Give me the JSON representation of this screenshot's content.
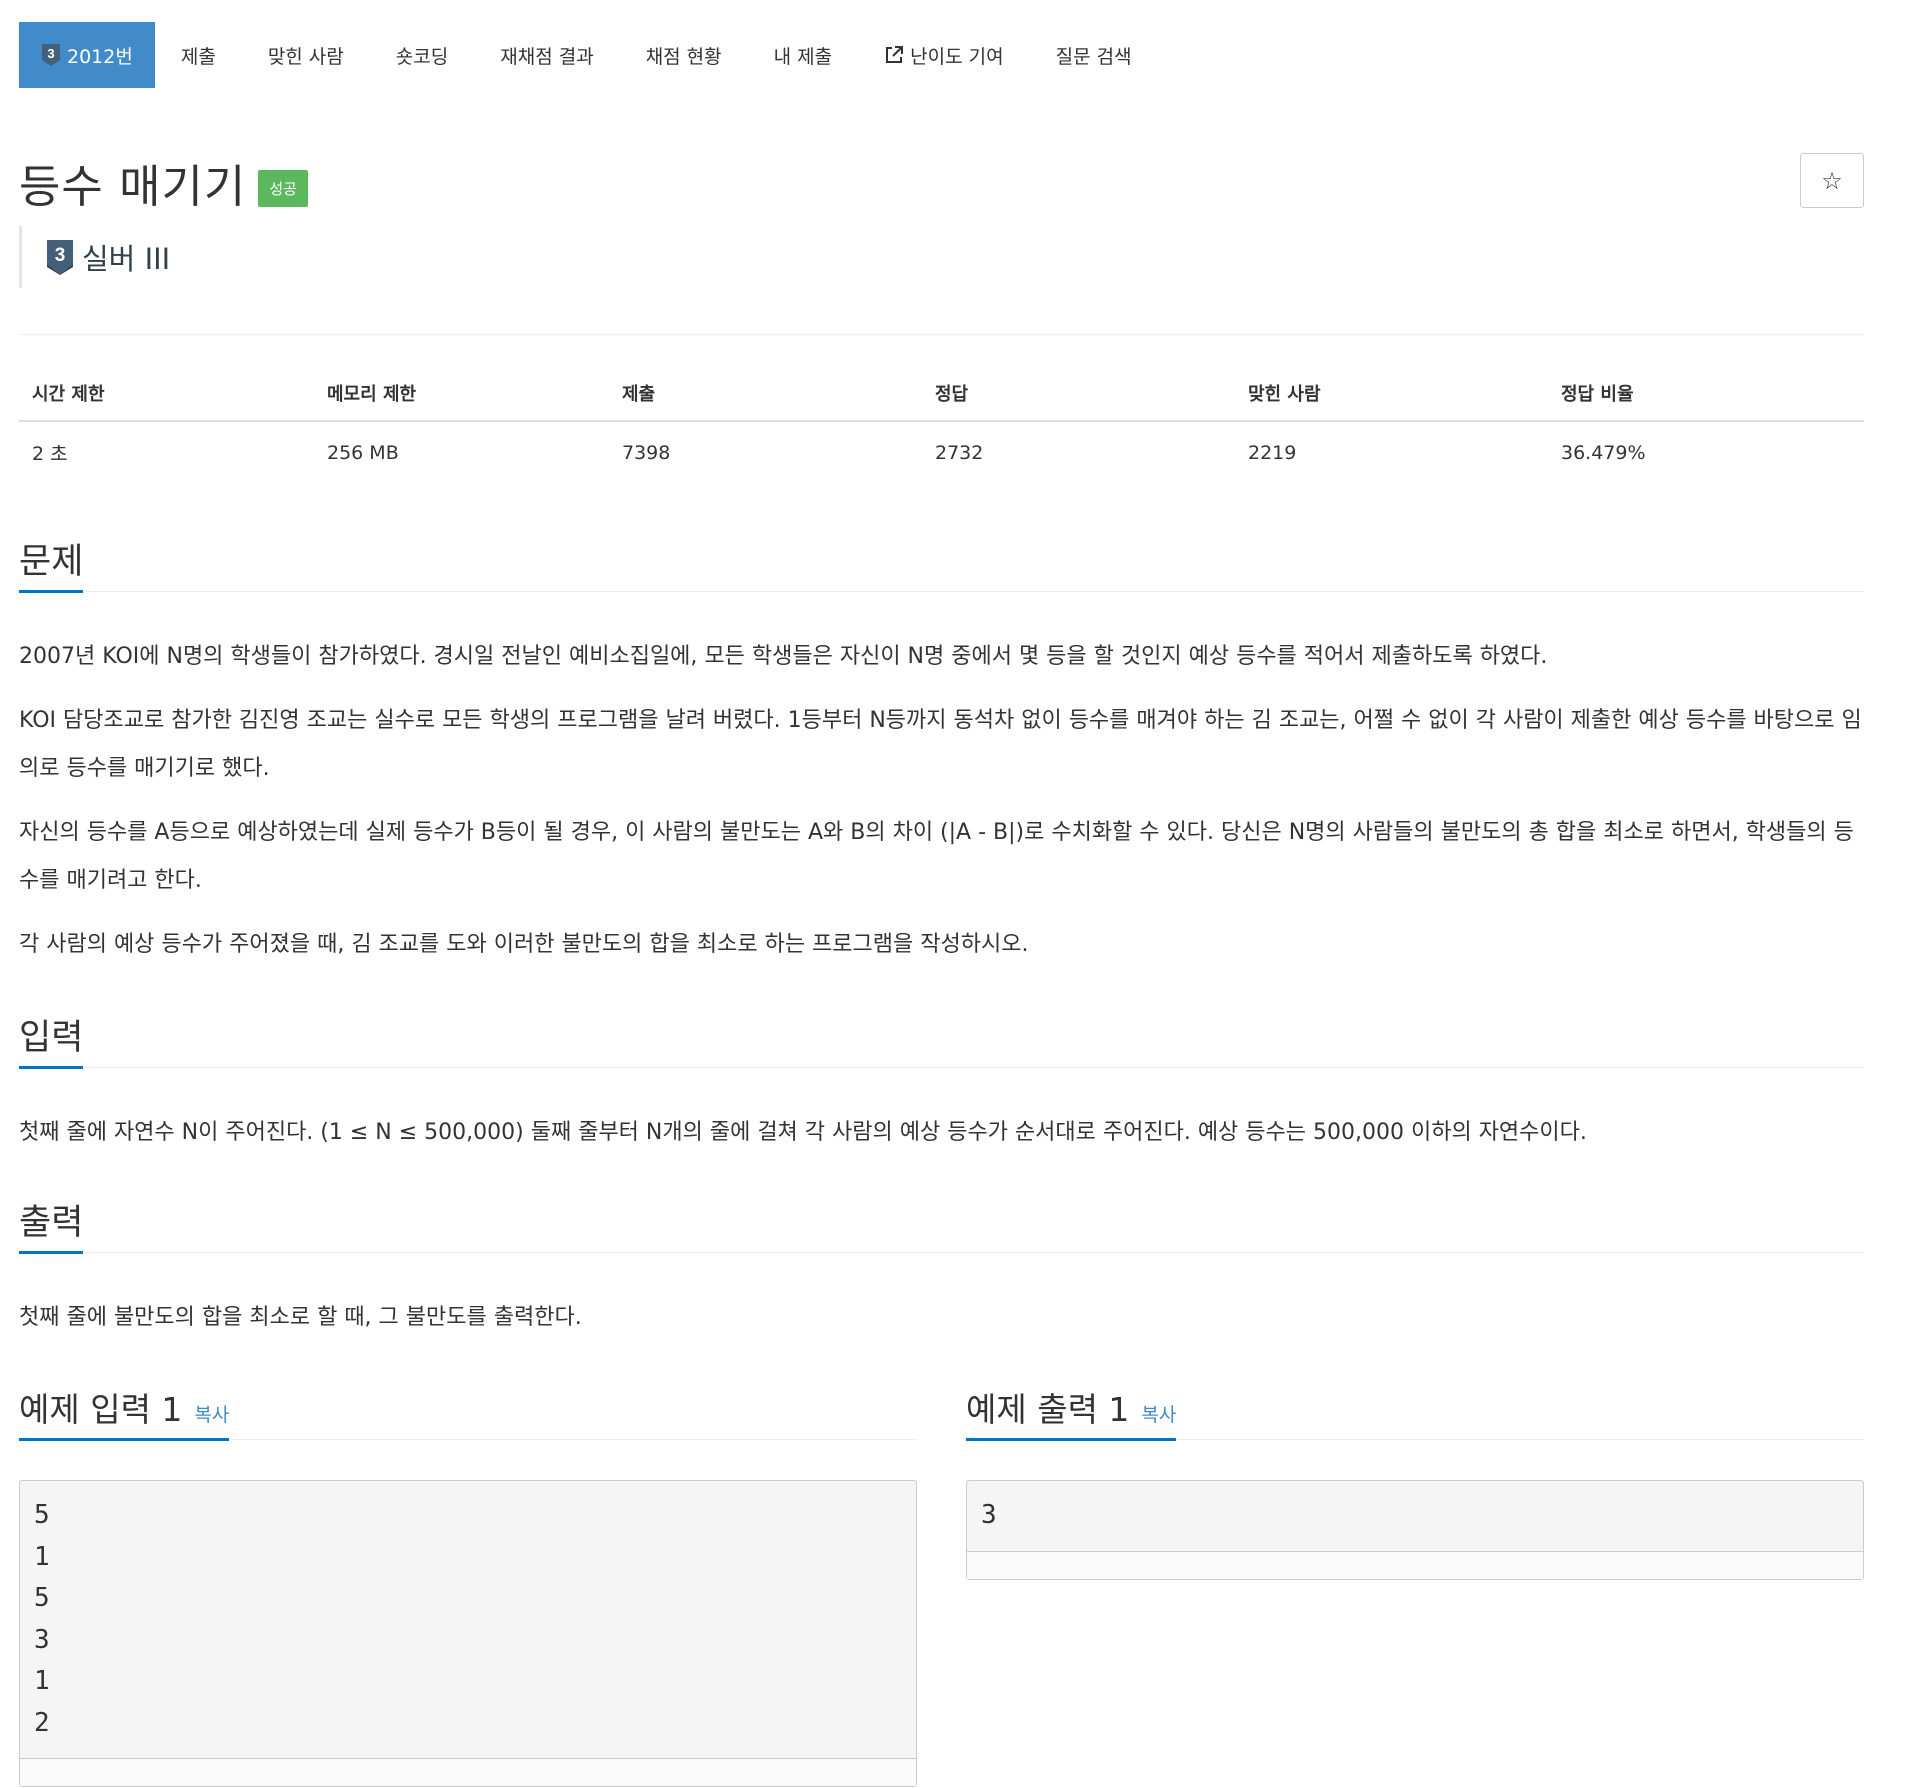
{
  "nav": {
    "problem_number": "2012번",
    "items": [
      "제출",
      "맞힌 사람",
      "숏코딩",
      "재채점 결과",
      "채점 현황",
      "내 제출",
      "난이도 기여",
      "질문 검색"
    ]
  },
  "title": "등수 매기기",
  "badge": "성공",
  "star_icon": "☆",
  "tier": {
    "number": "3",
    "label": "실버 III",
    "color": "#435f7a"
  },
  "stats": {
    "headers": [
      "시간 제한",
      "메모리 제한",
      "제출",
      "정답",
      "맞힌 사람",
      "정답 비율"
    ],
    "values": [
      "2 초",
      "256 MB",
      "7398",
      "2732",
      "2219",
      "36.479%"
    ]
  },
  "problem": {
    "heading": "문제",
    "paragraphs": [
      "2007년 KOI에 N명의 학생들이 참가하였다. 경시일 전날인 예비소집일에, 모든 학생들은 자신이 N명 중에서 몇 등을 할 것인지 예상 등수를 적어서 제출하도록 하였다.",
      "KOI 담당조교로 참가한 김진영 조교는 실수로 모든 학생의 프로그램을 날려 버렸다. 1등부터 N등까지 동석차 없이 등수를 매겨야 하는 김 조교는, 어쩔 수 없이 각 사람이 제출한 예상 등수를 바탕으로 임의로 등수를 매기기로 했다.",
      "자신의 등수를 A등으로 예상하였는데 실제 등수가 B등이 될 경우, 이 사람의 불만도는 A와 B의 차이 (|A - B|)로 수치화할 수 있다. 당신은 N명의 사람들의 불만도의 총 합을 최소로 하면서, 학생들의 등수를 매기려고 한다.",
      "각 사람의 예상 등수가 주어졌을 때, 김 조교를 도와 이러한 불만도의 합을 최소로 하는 프로그램을 작성하시오."
    ]
  },
  "input": {
    "heading": "입력",
    "text": "첫째 줄에 자연수 N이 주어진다. (1 ≤ N ≤ 500,000) 둘째 줄부터 N개의 줄에 걸쳐 각 사람의 예상 등수가 순서대로 주어진다. 예상 등수는 500,000 이하의 자연수이다."
  },
  "output": {
    "heading": "출력",
    "text": "첫째 줄에 불만도의 합을 최소로 할 때, 그 불만도를 출력한다."
  },
  "sample_input": {
    "heading": "예제 입력 1",
    "copy": "복사",
    "code": "5\n1\n5\n3\n1\n2"
  },
  "sample_output": {
    "heading": "예제 출력 1",
    "copy": "복사",
    "code": "3"
  }
}
